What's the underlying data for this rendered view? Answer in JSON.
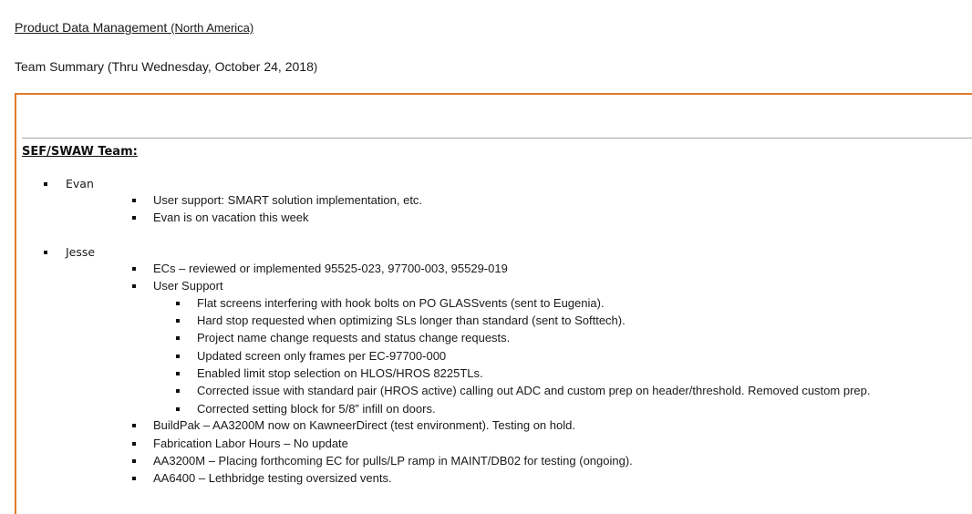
{
  "document": {
    "title_main": "Product Data Management ",
    "title_region": "(North America)",
    "subtitle_main": "Team Summary (Thru Wednesday, October 24, 2018",
    "subtitle_close": ")"
  },
  "section": {
    "heading": "SEF/SWAW Team:",
    "people": [
      {
        "name": "Evan",
        "items": [
          {
            "text": "User support: SMART solution implementation, etc."
          },
          {
            "text": "Evan is on vacation this week"
          }
        ]
      },
      {
        "name": "Jesse",
        "items": [
          {
            "text": "ECs – reviewed or implemented 95525-023, 97700-003, 95529-019"
          },
          {
            "text": "User Support",
            "subitems": [
              "Flat screens interfering with hook bolts on PO GLASSvents (sent to Eugenia).",
              "Hard stop requested when optimizing SLs longer than standard (sent to Softtech).",
              "Project name change requests and status change requests.",
              "Updated screen only frames per EC-97700-000",
              "Enabled limit stop selection on HLOS/HROS 8225TLs.",
              "Corrected issue with standard pair (HROS active) calling out ADC and custom prep on header/threshold.  Removed custom prep.",
              "Corrected setting block for 5/8” infill on doors."
            ]
          },
          {
            "text": "BuildPak – AA3200M now on KawneerDirect (test environment).  Testing on hold."
          },
          {
            "text": "Fabrication Labor Hours – No update"
          },
          {
            "text": "AA3200M – Placing forthcoming EC for pulls/LP ramp in MAINT/DB02 for testing (ongoing)."
          },
          {
            "text": "AA6400 – Lethbridge testing oversized vents."
          }
        ]
      }
    ]
  }
}
